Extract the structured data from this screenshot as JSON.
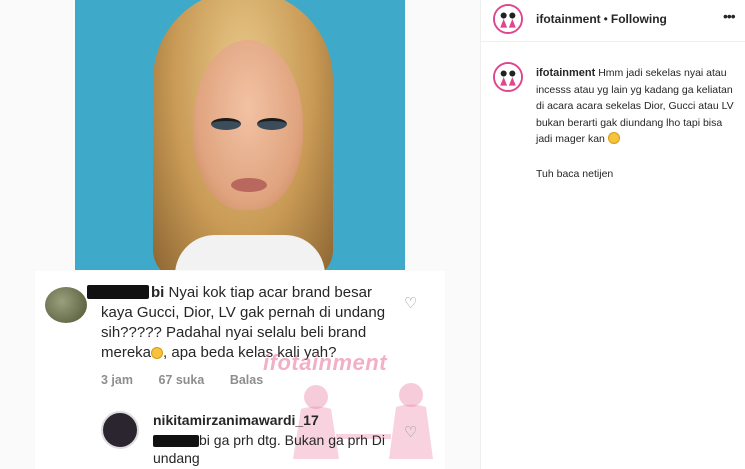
{
  "post": {
    "username": "ifotainment",
    "follow_status": "Following",
    "more_icon": "more-horizontal-icon",
    "caption_username": "ifotainment",
    "caption_text": "Hmm jadi sekelas nyai atau incesss atau yg lain yg kadang ga keliatan di acara acara sekelas Dior, Gucci atau LV bukan berarti gak diundang lho tapi bisa jadi mager kan",
    "caption_emoji": "smiling-face-emoji",
    "caption_line2": "Tuh baca netijen"
  },
  "comment_screenshot": {
    "comment1": {
      "username_tail": "bi",
      "text": "Nyai kok tiap acar brand besar kaya Gucci, Dior, LV gak pernah di undang sih????? Padahal nyai selalu beli brand mereka",
      "text_after_emoji": ", apa beda kelas kali yah?",
      "time": "3 jam",
      "likes": "67 suka",
      "reply": "Balas"
    },
    "comment2": {
      "username": "nikitamirzanimawardi_17",
      "username_mention_tail": "bi",
      "text": " ga prh dtg. Bukan ga prh Di undang"
    },
    "watermark": "ifotainment"
  },
  "colors": {
    "photo_bg": "#3fa9c9",
    "avatar_ring": "#e0468f",
    "watermark": "#e86e96"
  }
}
